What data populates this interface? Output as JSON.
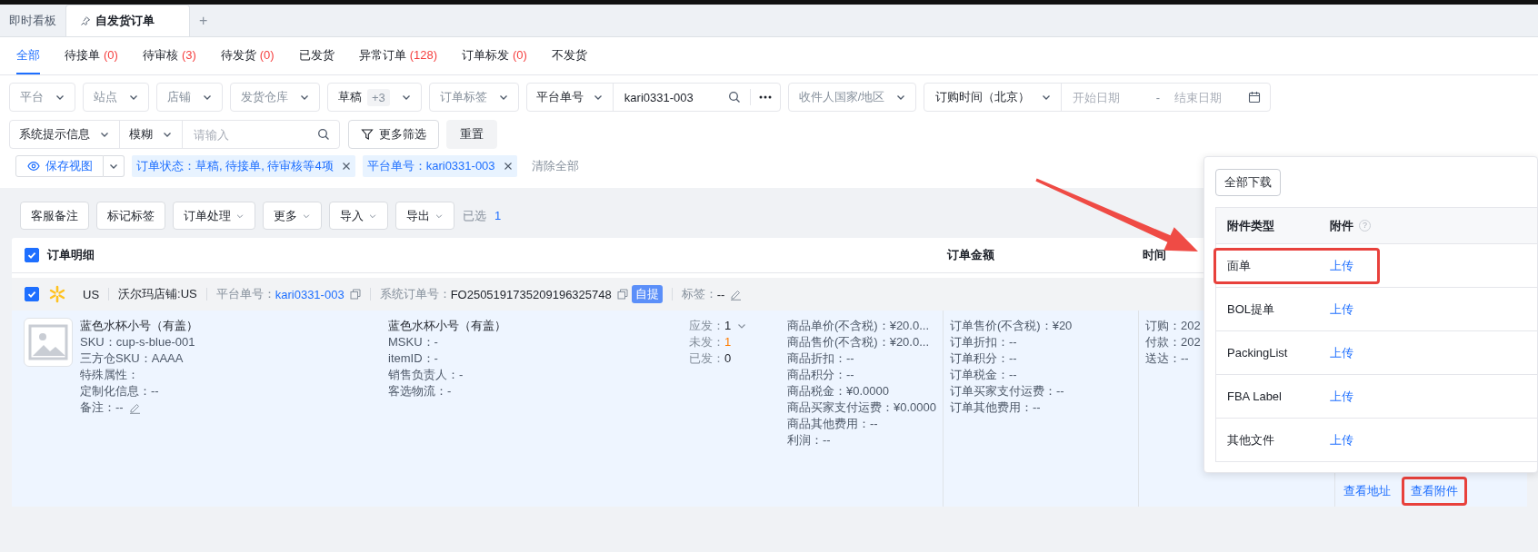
{
  "workspace_tabs": [
    {
      "label": "即时看板",
      "selected": false,
      "pinned": false
    },
    {
      "label": "自发货订单",
      "selected": true,
      "pinned": true
    }
  ],
  "add_tab": "+",
  "status_tabs": [
    {
      "label": "全部",
      "selected": true
    },
    {
      "label": "待接单",
      "count": "(0)",
      "selected": false
    },
    {
      "label": "待审核",
      "count": "(3)",
      "selected": false
    },
    {
      "label": "待发货",
      "count": "(0)",
      "selected": false
    },
    {
      "label": "已发货",
      "selected": false
    },
    {
      "label": "异常订单",
      "count": "(128)",
      "selected": false
    },
    {
      "label": "订单标发",
      "count": "(0)",
      "selected": false
    },
    {
      "label": "不发货",
      "selected": false
    }
  ],
  "filters_row1": [
    {
      "kind": "select",
      "placeholder": "平台"
    },
    {
      "kind": "select",
      "placeholder": "站点"
    },
    {
      "kind": "select",
      "placeholder": "店铺"
    },
    {
      "kind": "select",
      "placeholder": "发货仓库"
    },
    {
      "kind": "select",
      "value": "草稿",
      "extra": "+3"
    },
    {
      "kind": "select",
      "placeholder": "订单标签"
    },
    {
      "kind": "search",
      "field": "平台单号",
      "value": "kari0331-003"
    },
    {
      "kind": "select",
      "placeholder": "收件人国家/地区"
    },
    {
      "kind": "daterange",
      "field": "订购时间（北京）",
      "start_placeholder": "开始日期",
      "separator": "-",
      "end_placeholder": "结束日期"
    }
  ],
  "filters_row2": [
    {
      "kind": "search",
      "field": "系统提示信息",
      "mode": "模糊",
      "placeholder": "请输入"
    },
    {
      "kind": "button",
      "label": "更多筛选"
    },
    {
      "kind": "plain",
      "label": "重置"
    }
  ],
  "save_view": "保存视图",
  "chips": [
    {
      "label": "订单状态：草稿, 待接单, 待审核等4项"
    },
    {
      "label": "平台单号：kari0331-003"
    }
  ],
  "clear_all": "清除全部",
  "toolbar": [
    {
      "label": "客服备注",
      "dropdown": false
    },
    {
      "label": "标记标签",
      "dropdown": false
    },
    {
      "label": "订单处理",
      "dropdown": true
    },
    {
      "label": "更多",
      "dropdown": true
    },
    {
      "label": "导入",
      "dropdown": true
    },
    {
      "label": "导出",
      "dropdown": true
    }
  ],
  "selected_label": "已选",
  "selected_count": "1",
  "table": {
    "checked": true,
    "title": "订单明细",
    "columns": [
      "订单金额",
      "时间"
    ]
  },
  "order": {
    "checked": true,
    "site": "US",
    "store": "沃尔玛店铺:US",
    "platform_no_label": "平台单号：",
    "platform_no": "kari0331-003",
    "system_no_label": "系统订单号：",
    "system_no": "FO2505191735209196325748",
    "badge": "自提",
    "tag_label": "标签：",
    "tag_value": "--",
    "product": {
      "name": "蓝色水杯小号（有盖）",
      "lines": [
        {
          "text": "SKU：cup-s-blue-001",
          "editable": false
        },
        {
          "text": "三方仓SKU：AAAA",
          "editable": false
        },
        {
          "text": "特殊属性：",
          "editable": false
        },
        {
          "text": "定制化信息：--",
          "editable": false
        },
        {
          "text": "备注：--",
          "editable": true
        }
      ]
    },
    "msku": {
      "name": "蓝色水杯小号（有盖）",
      "lines": [
        "MSKU：-",
        "itemID：-",
        "销售负责人：-",
        "客选物流：-"
      ]
    },
    "quantities": [
      {
        "label": "应发：",
        "value": "1",
        "expandable": true,
        "highlight": false
      },
      {
        "label": "未发：",
        "value": "1",
        "expandable": false,
        "highlight": true
      },
      {
        "label": "已发：",
        "value": "0",
        "expandable": false,
        "highlight": false
      }
    ],
    "prices": [
      "商品单价(不含税)：¥20.0...",
      "商品售价(不含税)：¥20.0...",
      "商品折扣：--",
      "商品积分：--",
      "商品税金：¥0.0000",
      "商品买家支付运费：¥0.0000",
      "商品其他费用：--",
      "利润：--"
    ],
    "amounts": [
      "订单售价(不含税)：¥20",
      "订单折扣：--",
      "订单积分：--",
      "订单税金：--",
      "订单买家支付运费：--",
      "订单其他费用：--"
    ],
    "times": [
      "订购：202",
      "付款：202",
      "送达：--"
    ],
    "actions": [
      {
        "label": "查看地址",
        "highlighted": false
      },
      {
        "label": "查看附件",
        "highlighted": true
      }
    ]
  },
  "popover": {
    "download_all": "全部下载",
    "columns": [
      "附件类型",
      "附件"
    ],
    "help_icon": "?",
    "rows": [
      {
        "type": "面单",
        "action": "上传",
        "highlighted": true
      },
      {
        "type": "BOL提单",
        "action": "上传",
        "highlighted": false
      },
      {
        "type": "PackingList",
        "action": "上传",
        "highlighted": false
      },
      {
        "type": "FBA Label",
        "action": "上传",
        "highlighted": false
      },
      {
        "type": "其他文件",
        "action": "上传",
        "highlighted": false
      }
    ]
  }
}
